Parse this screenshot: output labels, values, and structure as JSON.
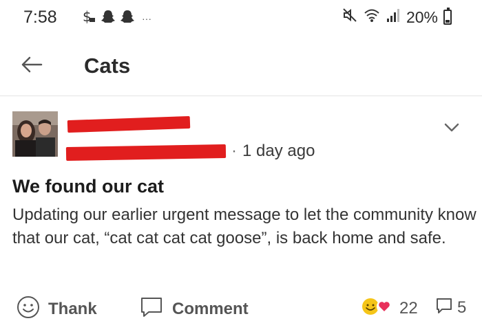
{
  "status_bar": {
    "time": "7:58",
    "battery": "20%",
    "more_indicator": "···",
    "icons": [
      "money-hand-icon",
      "snapchat-icon",
      "snapchat-icon",
      "mute-icon",
      "wifi-icon",
      "signal-icon",
      "battery-icon"
    ]
  },
  "header": {
    "title": "Cats",
    "back_icon": "arrow-left-icon"
  },
  "post": {
    "posted_time": "1 day ago",
    "separator": "·",
    "title": "We found our cat",
    "body": "Updating our earlier urgent message to let the community know that our cat, “cat cat cat cat goose”, is back home and safe.",
    "actions": {
      "thank_label": "Thank",
      "comment_label": "Comment"
    },
    "reaction_count": "22",
    "comment_count": "5",
    "colors": {
      "redaction": "#e11e1e",
      "heart": "#e8315b",
      "smiley": "#f5c518"
    }
  }
}
